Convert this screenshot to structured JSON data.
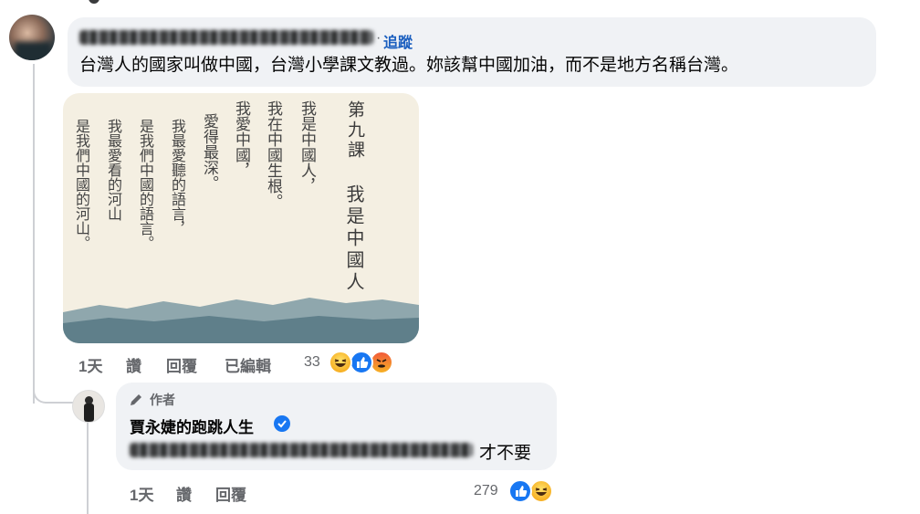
{
  "comment": {
    "follow_label": "追蹤",
    "separator": "·",
    "text": "台灣人的國家叫做中國，台灣小學課文教過。妳該幫中國加油，而不是地方名稱台灣。",
    "image": {
      "lesson_title": "第九課",
      "lesson_name": "我是中國人",
      "columns": [
        "我是中國人，",
        "我在中國生根。",
        "我愛中國，",
        "愛得最深。",
        "我最愛聽的語言，",
        "是我們中國的語言。",
        "我最愛看的河山",
        "是我們中國的河山。"
      ]
    },
    "actions": {
      "time": "1天",
      "like": "讚",
      "reply": "回覆",
      "edited": "已編輯"
    },
    "reaction_count": "33",
    "reaction_icons": [
      "haha-icon",
      "like-icon",
      "angry-icon"
    ]
  },
  "reply": {
    "author_badge": "作者",
    "author_name": "賈永婕的跑跳人生",
    "text": "才不要",
    "actions": {
      "time": "1天",
      "like": "讚",
      "reply": "回覆"
    },
    "reaction_count": "279",
    "reaction_icons": [
      "like-icon",
      "haha-icon"
    ]
  },
  "colors": {
    "bubble": "#f0f2f5",
    "link": "#1b5fbf",
    "meta": "#65676b",
    "like": "#1877f2"
  }
}
